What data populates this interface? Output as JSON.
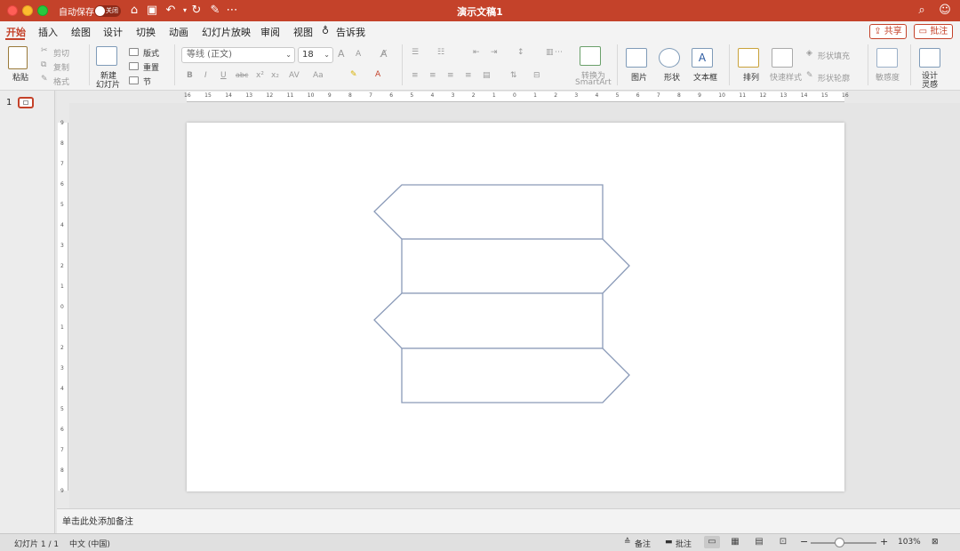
{
  "titlebar": {
    "autosave_label": "自动保存",
    "autosave_state": "关闭",
    "doc_title": "演示文稿1",
    "icons": [
      "home-icon",
      "save-icon",
      "undo-icon",
      "redo-icon",
      "customize-icon",
      "more-icon",
      "search-icon",
      "smiley-icon"
    ]
  },
  "tabs": [
    {
      "label": "开始",
      "active": true
    },
    {
      "label": "插入"
    },
    {
      "label": "绘图"
    },
    {
      "label": "设计"
    },
    {
      "label": "切换"
    },
    {
      "label": "动画"
    },
    {
      "label": "幻灯片放映"
    },
    {
      "label": "审阅"
    },
    {
      "label": "视图"
    },
    {
      "label": "告诉我"
    }
  ],
  "actions": {
    "share": "共享",
    "comment": "批注"
  },
  "ribbon": {
    "paste": "粘贴",
    "cut": "剪切",
    "copy": "复制",
    "format": "格式",
    "new_slide_line1": "新建",
    "new_slide_line2": "幻灯片",
    "layout": "版式",
    "reset": "重置",
    "section": "节",
    "font_name": "等线 (正文)",
    "font_size": "18",
    "bold": "B",
    "italic": "I",
    "underline": "U",
    "strike": "abc",
    "superscript": "x²",
    "subscript": "x₂",
    "spacing": "AV",
    "change_case": "Aa",
    "grow_font": "A",
    "shrink_font": "A",
    "smartart_line1": "转换为",
    "smartart_line2": "SmartArt",
    "picture": "图片",
    "shapes": "形状",
    "textbox": "文本框",
    "arrange": "排列",
    "quick_styles": "快速样式",
    "shape_fill": "形状填充",
    "shape_outline": "形状轮廓",
    "sensitivity": "敏感度",
    "designer_line1": "设计",
    "designer_line2": "灵感"
  },
  "ruler": {
    "h_labels": [
      "16",
      "15",
      "14",
      "13",
      "12",
      "11",
      "10",
      "9",
      "8",
      "7",
      "6",
      "5",
      "4",
      "3",
      "2",
      "1",
      "0",
      "1",
      "2",
      "3",
      "4",
      "5",
      "6",
      "7",
      "8",
      "9",
      "10",
      "11",
      "12",
      "13",
      "14",
      "15",
      "16"
    ],
    "v_labels": [
      "9",
      "8",
      "7",
      "6",
      "5",
      "4",
      "3",
      "2",
      "1",
      "0",
      "1",
      "2",
      "3",
      "4",
      "5",
      "6",
      "7",
      "8",
      "9"
    ]
  },
  "thumbnails": {
    "slide_number": "1"
  },
  "notes": {
    "placeholder": "单击此处添加备注"
  },
  "statusbar": {
    "slide_count": "幻灯片 1 / 1",
    "language": "中文 (中国)",
    "notes": "备注",
    "comments": "批注",
    "zoom_minus": "−",
    "zoom_plus": "+",
    "zoom": "103%",
    "zoom_fraction": 0.43
  },
  "colors": {
    "accent": "#c4422a",
    "shape_stroke": "#8a9ab8"
  }
}
